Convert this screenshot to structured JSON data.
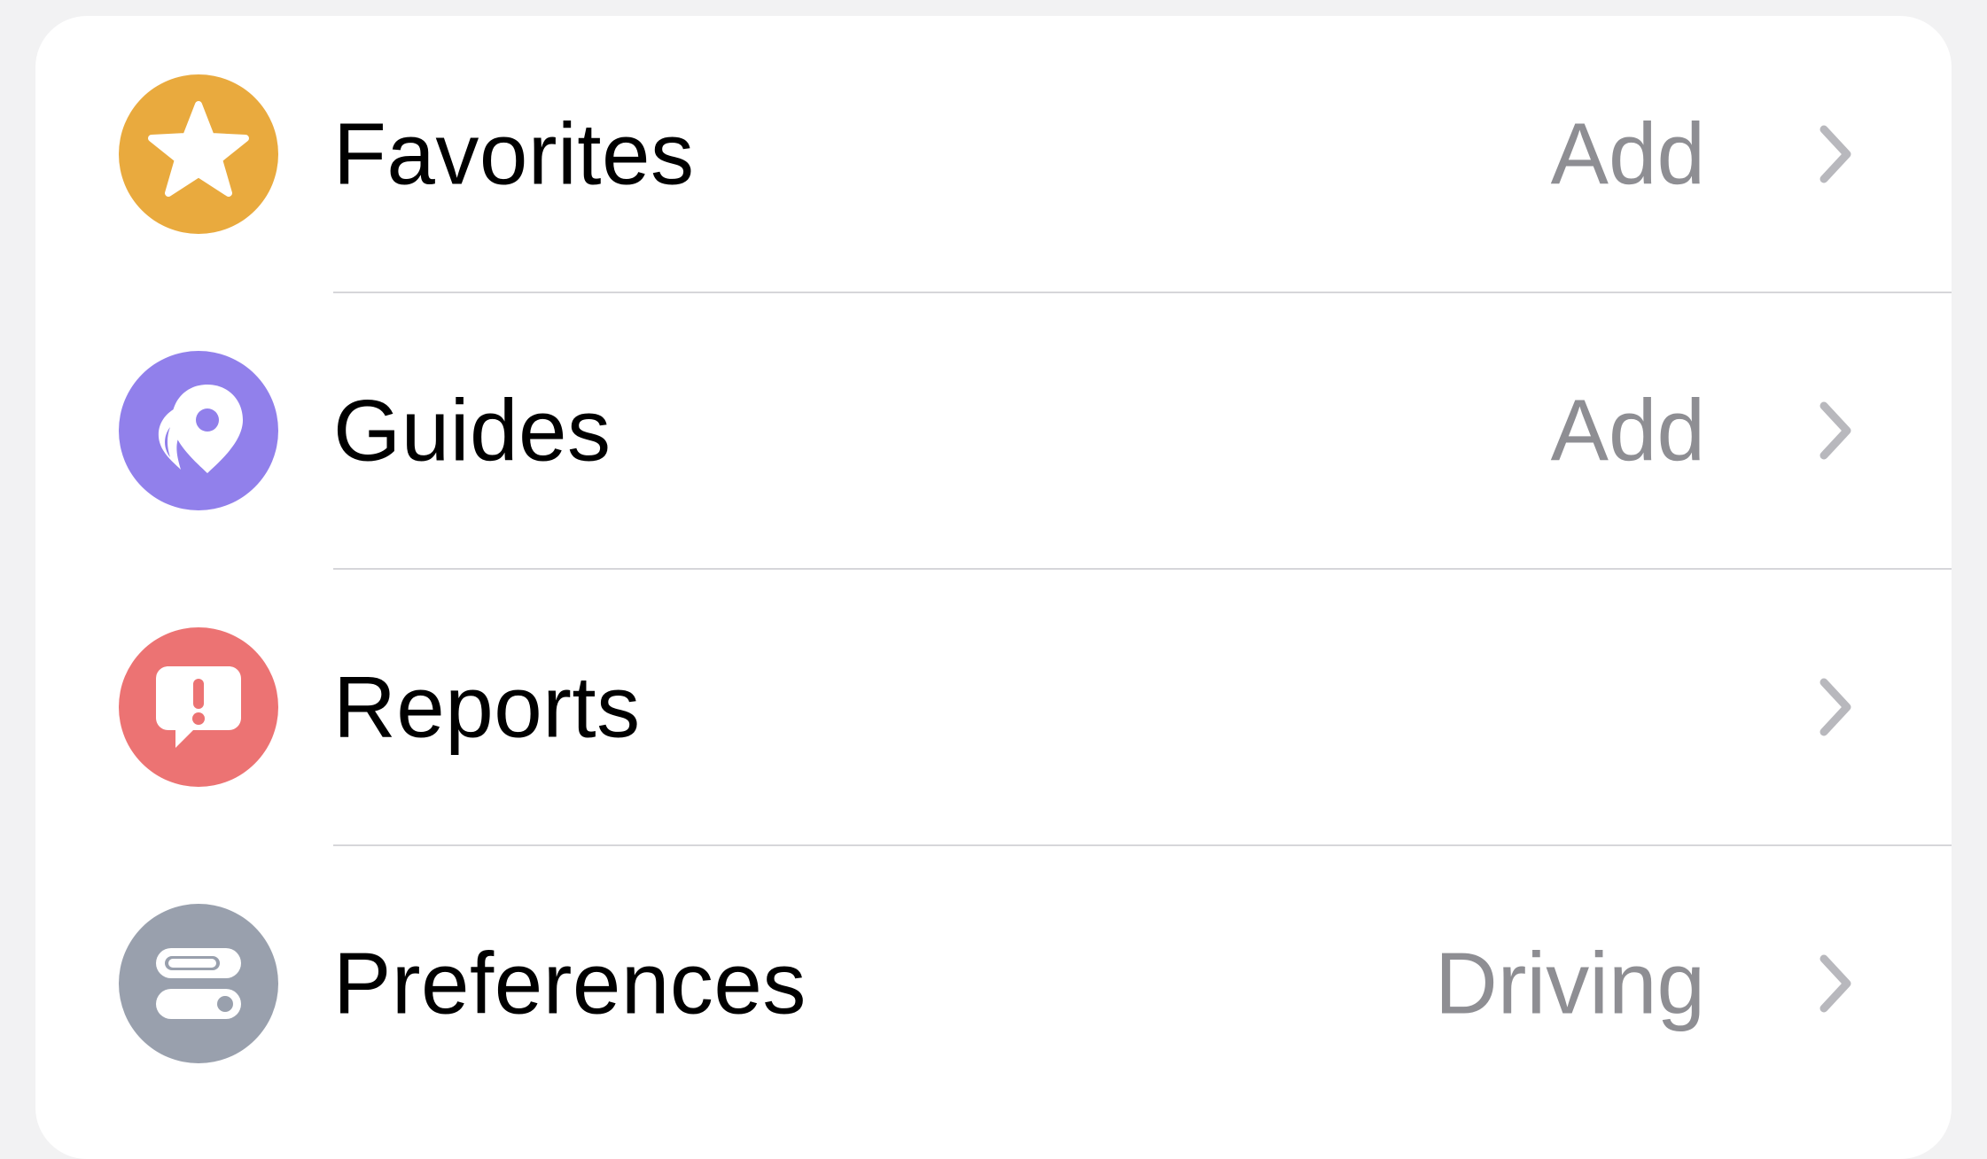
{
  "settings_list": {
    "items": [
      {
        "label": "Favorites",
        "value": "Add",
        "icon": "star-icon",
        "icon_color": "#e9aa3e"
      },
      {
        "label": "Guides",
        "value": "Add",
        "icon": "guides-pin-icon",
        "icon_color": "#9180eb"
      },
      {
        "label": "Reports",
        "value": "",
        "icon": "report-bubble-icon",
        "icon_color": "#ec7373"
      },
      {
        "label": "Preferences",
        "value": "Driving",
        "icon": "toggles-icon",
        "icon_color": "#99a0ad"
      }
    ],
    "chevron_icon": "chevron-right-icon",
    "label_color": "#000000",
    "value_color": "#8e8e93",
    "chevron_color": "#b8b8bd",
    "background_color": "#ffffff"
  }
}
